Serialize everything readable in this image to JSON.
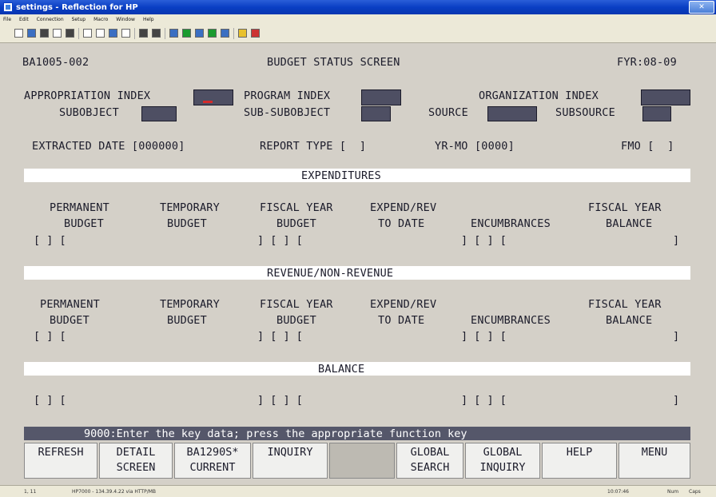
{
  "window": {
    "title": "settings - Reflection for HP",
    "menus": [
      "File",
      "Edit",
      "Connection",
      "Setup",
      "Macro",
      "Window",
      "Help"
    ]
  },
  "header": {
    "screen_id": "BA1005-002",
    "screen_title": "BUDGET STATUS SCREEN",
    "fiscal_year": "FYR:08-09"
  },
  "key_fields": {
    "appropriation_index_label": "APPROPRIATION INDEX",
    "program_index_label": "PROGRAM INDEX",
    "organization_index_label": "ORGANIZATION INDEX",
    "subobject_label": "SUBOBJECT",
    "sub_subobject_label": "SUB-SUBOBJECT",
    "source_label": "SOURCE",
    "subsource_label": "SUBSOURCE"
  },
  "info_line": {
    "extracted_date": "EXTRACTED DATE [000000]",
    "report_type": "REPORT TYPE [  ]",
    "yr_mo": "YR-MO [0000]",
    "fmo": "FMO [  ]"
  },
  "sections": {
    "expenditures": "EXPENDITURES",
    "revenue": "REVENUE/NON-REVENUE",
    "balance": "BALANCE"
  },
  "columns": {
    "permanent_1": "PERMANENT",
    "permanent_2": "BUDGET",
    "temporary_1": "TEMPORARY",
    "temporary_2": "BUDGET",
    "fiscal_budget_1": "FISCAL YEAR",
    "fiscal_budget_2": "BUDGET",
    "expend_1": "EXPEND/REV",
    "expend_2": "TO DATE",
    "encumbrances": "ENCUMBRANCES",
    "fiscal_balance_1": "FISCAL YEAR",
    "fiscal_balance_2": "BALANCE"
  },
  "message": "9000:Enter the key data; press the appropriate function key",
  "function_keys": {
    "f1_1": "REFRESH",
    "f1_2": "",
    "f2_1": "DETAIL",
    "f2_2": "SCREEN",
    "f3_1": "BA1290S*",
    "f3_2": "CURRENT",
    "f4_1": "INQUIRY",
    "f4_2": "",
    "f6_1": "GLOBAL",
    "f6_2": "SEARCH",
    "f7_1": "GLOBAL",
    "f7_2": "INQUIRY",
    "f8_1": "HELP",
    "f8_2": "",
    "f9_1": "MENU",
    "f9_2": ""
  },
  "statusbar": {
    "left": "1, 11",
    "center": "HP7000 - 134.39.4.22 via HTTP/MB",
    "time": "10:07:46",
    "mode1": "Num",
    "mode2": "Caps"
  },
  "colors": {
    "terminal_bg": "#d4d0c8",
    "field_fill": "#4e4f63",
    "message_bar": "#55576a",
    "titlebar": "#0a3fc4"
  }
}
